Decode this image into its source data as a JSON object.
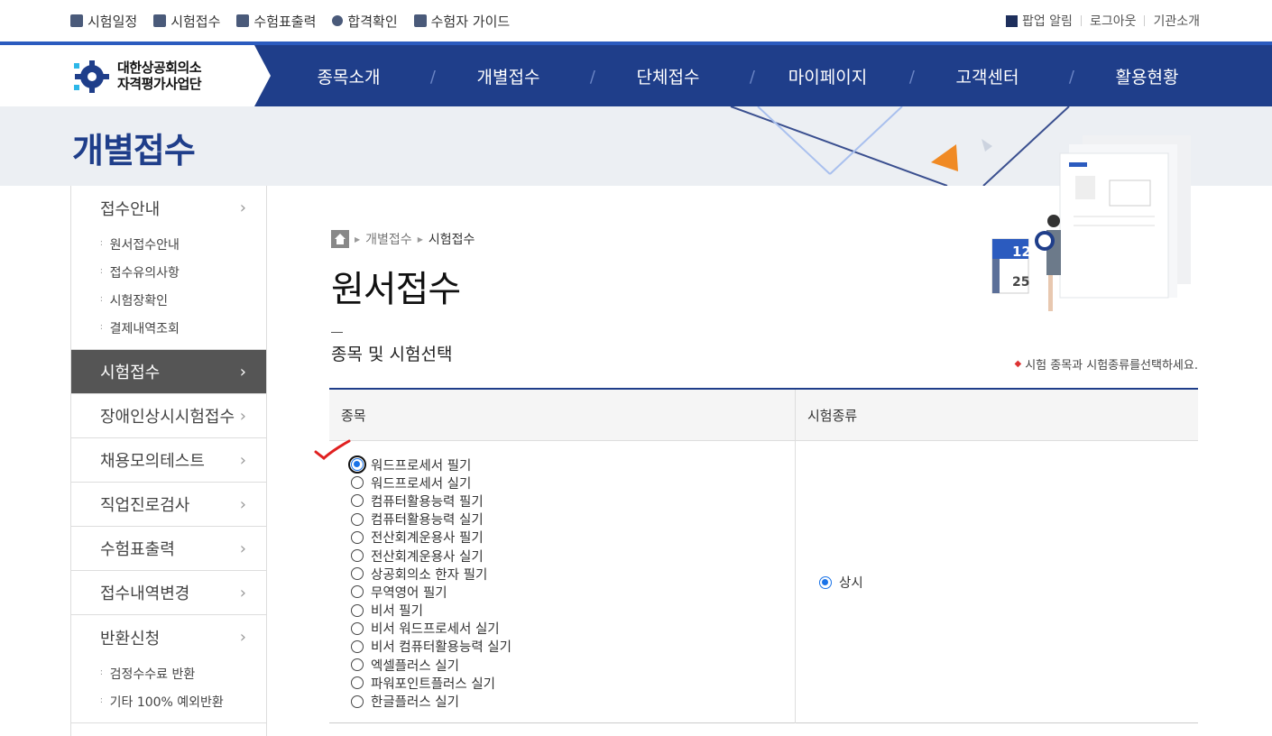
{
  "util_links": [
    {
      "label": "시험일정",
      "icon": "calendar-icon"
    },
    {
      "label": "시험접수",
      "icon": "pen-icon"
    },
    {
      "label": "수험표출력",
      "icon": "print-icon"
    },
    {
      "label": "합격확인",
      "icon": "ribbon-icon"
    },
    {
      "label": "수험자 가이드",
      "icon": "book-icon"
    }
  ],
  "util_right": {
    "popup": "팝업 알림",
    "logout": "로그아웃",
    "about": "기관소개"
  },
  "logo": {
    "line1": "대한상공회의소",
    "line2": "자격평가사업단"
  },
  "menu": [
    "종목소개",
    "개별접수",
    "단체접수",
    "마이페이지",
    "고객센터",
    "활용현황"
  ],
  "banner_title": "개별접수",
  "sidebar": {
    "guide": "접수안내",
    "guide_subs": [
      "원서접수안내",
      "접수유의사항",
      "시험장확인",
      "결제내역조회"
    ],
    "exam_apply": "시험접수",
    "disabled_apply": "장애인상시시험접수",
    "mock_test": "채용모의테스트",
    "career_test": "직업진로검사",
    "ticket_print": "수험표출력",
    "change": "접수내역변경",
    "refund": "반환신청",
    "refund_subs": [
      "검정수수료 반환",
      "기타 100% 예외반환"
    ]
  },
  "breadcrumb": {
    "parent": "개별접수",
    "current": "시험접수"
  },
  "page_title": "원서접수",
  "section_title": "종목 및 시험선택",
  "section_hint": "시험 종목과 시험종류를선택하세요.",
  "table": {
    "col1": "종목",
    "col2": "시험종류",
    "subjects": [
      "워드프로세서 필기",
      "워드프로세서 실기",
      "컴퓨터활용능력 필기",
      "컴퓨터활용능력 실기",
      "전산회계운용사 필기",
      "전산회계운용사 실기",
      "상공회의소 한자 필기",
      "무역영어 필기",
      "비서 필기",
      "비서 워드프로세서 실기",
      "비서 컴퓨터활용능력 실기",
      "엑셀플러스 실기",
      "파워포인트플러스 실기",
      "한글플러스 실기"
    ],
    "selected_subject_index": 0,
    "exam_type": "상시"
  },
  "colors": {
    "navy": "#1f3e8a",
    "accent": "#2b5bbf",
    "radio": "#1a73e8",
    "check": "#e02020"
  }
}
